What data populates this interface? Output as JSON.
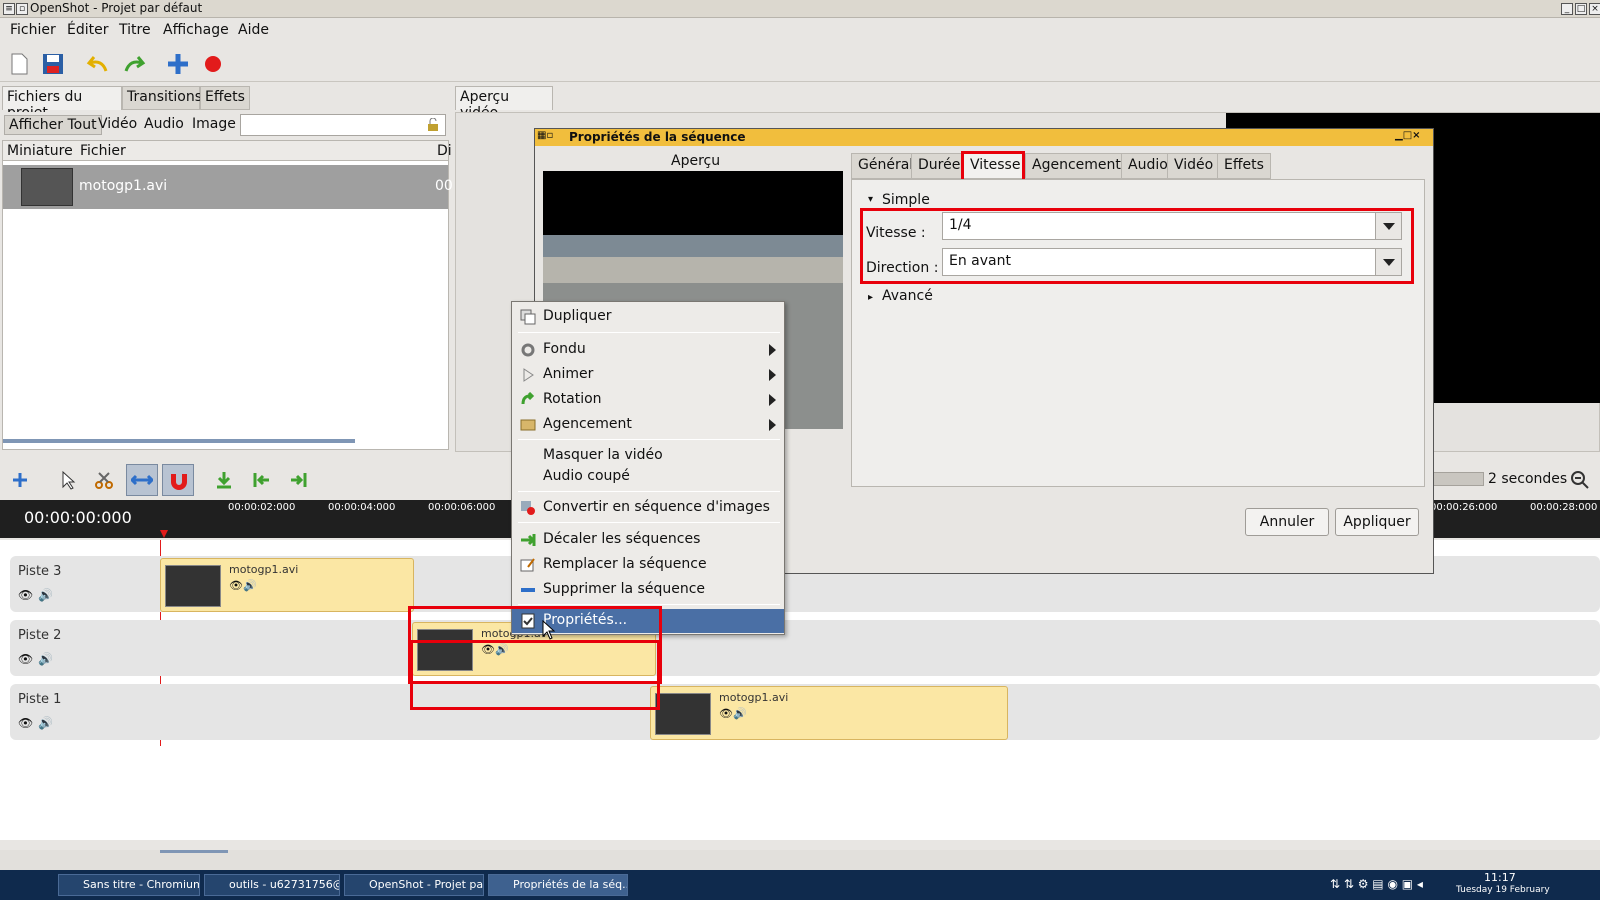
{
  "window": {
    "title": "OpenShot - Projet par défaut"
  },
  "menu": [
    "Fichier",
    "Éditer",
    "Titre",
    "Affichage",
    "Aide"
  ],
  "left_tabs": [
    "Fichiers du projet",
    "Transitions",
    "Effets"
  ],
  "filter_tabs": [
    "Afficher Tout",
    "Vidéo",
    "Audio",
    "Image"
  ],
  "columns": [
    "Miniature",
    "Fichier",
    "Di"
  ],
  "files": [
    {
      "name": "motogp1.avi",
      "extra": "00"
    }
  ],
  "preview_tab": "Aperçu vidéo",
  "timeline": {
    "timecode": "00:00:00:000",
    "ticks": [
      "00:00:02:000",
      "00:00:04:000",
      "00:00:06:000",
      "00:00:26:000",
      "00:00:28:000"
    ],
    "zoom_label": "2 secondes",
    "tracks": [
      {
        "label": "Piste 3",
        "clip": "motogp1.avi"
      },
      {
        "label": "Piste 2",
        "clip": "motogp1.avi"
      },
      {
        "label": "Piste 1",
        "clip": "motogp1.avi"
      }
    ]
  },
  "dialog": {
    "title": "Propriétés de la séquence",
    "preview_label": "Aperçu",
    "tabs": [
      "Général",
      "Durée",
      "Vitesse",
      "Agencement",
      "Audio",
      "Vidéo",
      "Effets"
    ],
    "section_simple": "Simple",
    "section_advanced": "Avancé",
    "speed_label": "Vitesse :",
    "speed_value": "1/4",
    "direction_label": "Direction :",
    "direction_value": "En avant",
    "cancel": "Annuler",
    "apply": "Appliquer"
  },
  "context_menu": {
    "items": [
      "Dupliquer",
      "Fondu",
      "Animer",
      "Rotation",
      "Agencement",
      "Masquer la vidéo",
      "Audio coupé",
      "Convertir en séquence d'images",
      "Décaler les séquences",
      "Remplacer la séquence",
      "Supprimer la séquence",
      "Propriétés..."
    ]
  },
  "taskbar": {
    "tasks": [
      "Sans titre - Chromium",
      "outils - u62731756@...",
      "OpenShot - Projet pa...",
      "Propriétés de la séq..."
    ],
    "time": "11:17",
    "date": "Tuesday 19 February"
  },
  "colors": {
    "highlight": "#e8000b",
    "dialog_title": "#f1be3d",
    "clip": "#fbe7a4",
    "menu_selected": "#4a6fa5"
  }
}
